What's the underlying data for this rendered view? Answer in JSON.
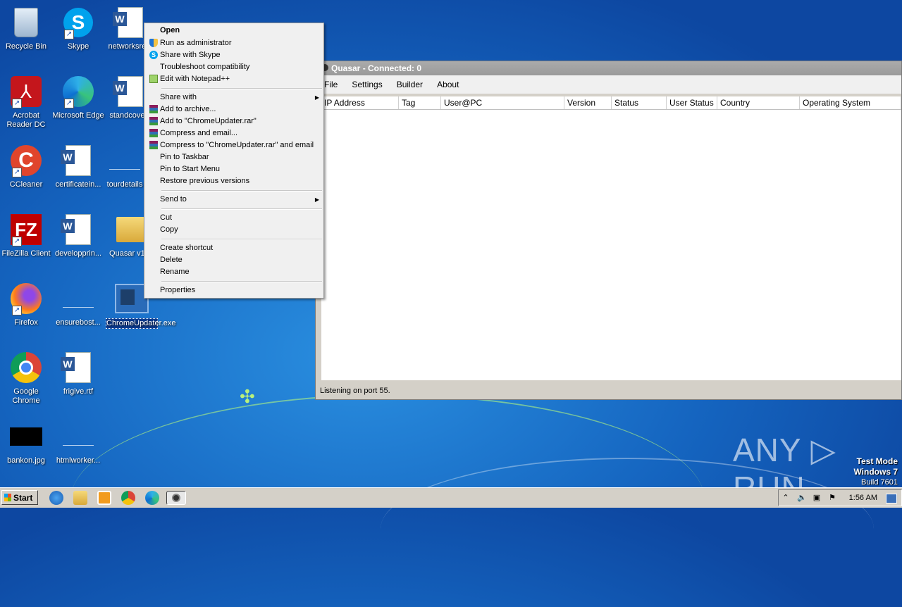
{
  "desktop": {
    "icons": [
      {
        "label": "Recycle Bin"
      },
      {
        "label": "Skype"
      },
      {
        "label": "networksre..."
      },
      {
        "label": "Acrobat Reader DC"
      },
      {
        "label": "Microsoft Edge"
      },
      {
        "label": "standcove..."
      },
      {
        "label": "CCleaner"
      },
      {
        "label": "certificatein..."
      },
      {
        "label": "tourdetails"
      },
      {
        "label": "FileZilla Client"
      },
      {
        "label": "developprin..."
      },
      {
        "label": "Quasar v1..."
      },
      {
        "label": "Firefox"
      },
      {
        "label": "ensurebost..."
      },
      {
        "label": "ChromeUpdater.exe"
      },
      {
        "label": "Google Chrome"
      },
      {
        "label": "frigive.rtf"
      },
      {
        "label": "bankon.jpg"
      },
      {
        "label": "htmlworker..."
      }
    ]
  },
  "quasar": {
    "title": "Quasar - Connected: 0",
    "menu": [
      "File",
      "Settings",
      "Builder",
      "About"
    ],
    "columns": [
      "IP Address",
      "Tag",
      "User@PC",
      "Version",
      "Status",
      "User Status",
      "Country",
      "Operating System"
    ],
    "status": "Listening on port 55."
  },
  "context_menu": {
    "items": [
      {
        "label": "Open",
        "bold": true,
        "icon": ""
      },
      {
        "label": "Run as administrator",
        "icon": "uac-shield-icon"
      },
      {
        "label": "Share with Skype",
        "icon": "skype-icon"
      },
      {
        "label": "Troubleshoot compatibility",
        "icon": ""
      },
      {
        "label": "Edit with Notepad++",
        "icon": "notepadpp-icon"
      },
      {
        "label": "Share with",
        "submenu": true
      },
      {
        "label": "Add to archive...",
        "icon": "winrar-icon"
      },
      {
        "label": "Add to \"ChromeUpdater.rar\"",
        "icon": "winrar-icon"
      },
      {
        "label": "Compress and email...",
        "icon": "winrar-icon"
      },
      {
        "label": "Compress to \"ChromeUpdater.rar\" and email",
        "icon": "winrar-icon"
      },
      {
        "label": "Pin to Taskbar"
      },
      {
        "label": "Pin to Start Menu"
      },
      {
        "label": "Restore previous versions"
      },
      {
        "label": "Send to",
        "submenu": true
      },
      {
        "label": "Cut"
      },
      {
        "label": "Copy"
      },
      {
        "label": "Create shortcut"
      },
      {
        "label": "Delete"
      },
      {
        "label": "Rename"
      },
      {
        "label": "Properties"
      }
    ]
  },
  "watermark": {
    "text": "ANY ▷ RUN",
    "test_mode": "Test Mode",
    "os": "Windows 7",
    "build": "Build 7601"
  },
  "taskbar": {
    "start_label": "Start",
    "pinned": [
      "internet-explorer-icon",
      "explorer-icon",
      "media-player-icon",
      "chrome-icon",
      "edge-icon",
      "quasar-icon"
    ],
    "clock": "1:56 AM"
  }
}
